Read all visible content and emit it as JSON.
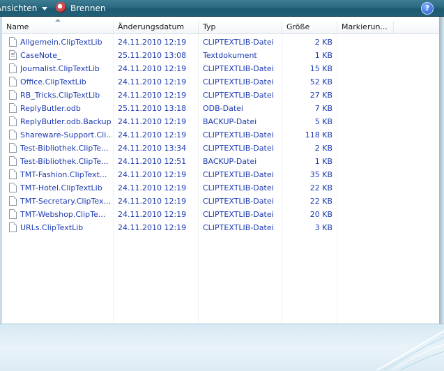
{
  "toolbar": {
    "views_label": "Ansichten",
    "burn_label": "Brennen",
    "help_label": "?"
  },
  "columns": {
    "name": "Name",
    "date": "Änderungsdatum",
    "type": "Typ",
    "size": "Größe",
    "tags": "Markierun..."
  },
  "files": [
    {
      "name": "Allgemein.ClipTextLib",
      "date": "24.11.2010 12:19",
      "type": "CLIPTEXTLIB-Datei",
      "size": "2 KB",
      "icon": "file-icon"
    },
    {
      "name": "CaseNote_",
      "date": "25.11.2010 13:08",
      "type": "Textdokument",
      "size": "1 KB",
      "icon": "text-file-icon"
    },
    {
      "name": "Journalist.ClipTextLib",
      "date": "24.11.2010 12:19",
      "type": "CLIPTEXTLIB-Datei",
      "size": "15 KB",
      "icon": "file-icon"
    },
    {
      "name": "Office.ClipTextLib",
      "date": "24.11.2010 12:19",
      "type": "CLIPTEXTLIB-Datei",
      "size": "52 KB",
      "icon": "file-icon"
    },
    {
      "name": "RB_Tricks.ClipTextLib",
      "date": "24.11.2010 12:19",
      "type": "CLIPTEXTLIB-Datei",
      "size": "27 KB",
      "icon": "file-icon"
    },
    {
      "name": "ReplyButler.odb",
      "date": "25.11.2010 13:18",
      "type": "ODB-Datei",
      "size": "7 KB",
      "icon": "file-icon"
    },
    {
      "name": "ReplyButler.odb.Backup",
      "date": "24.11.2010 12:19",
      "type": "BACKUP-Datei",
      "size": "5 KB",
      "icon": "file-icon"
    },
    {
      "name": "Shareware-Support.Cli...",
      "date": "24.11.2010 12:19",
      "type": "CLIPTEXTLIB-Datei",
      "size": "118 KB",
      "icon": "file-icon"
    },
    {
      "name": "Test-Bibliothek.ClipTe...",
      "date": "24.11.2010 13:34",
      "type": "CLIPTEXTLIB-Datei",
      "size": "2 KB",
      "icon": "file-icon"
    },
    {
      "name": "Test-Bibliothek.ClipTe...",
      "date": "24.11.2010 12:51",
      "type": "BACKUP-Datei",
      "size": "1 KB",
      "icon": "file-icon"
    },
    {
      "name": "TMT-Fashion.ClipText...",
      "date": "24.11.2010 12:19",
      "type": "CLIPTEXTLIB-Datei",
      "size": "35 KB",
      "icon": "file-icon"
    },
    {
      "name": "TMT-Hotel.ClipTextLib",
      "date": "24.11.2010 12:19",
      "type": "CLIPTEXTLIB-Datei",
      "size": "22 KB",
      "icon": "file-icon"
    },
    {
      "name": "TMT-Secretary.ClipTex...",
      "date": "24.11.2010 12:19",
      "type": "CLIPTEXTLIB-Datei",
      "size": "22 KB",
      "icon": "file-icon"
    },
    {
      "name": "TMT-Webshop.ClipTe...",
      "date": "24.11.2010 12:19",
      "type": "CLIPTEXTLIB-Datei",
      "size": "20 KB",
      "icon": "file-icon"
    },
    {
      "name": "URLs.ClipTextLib",
      "date": "24.11.2010 12:19",
      "type": "CLIPTEXTLIB-Datei",
      "size": "3 KB",
      "icon": "file-icon"
    }
  ],
  "colors": {
    "toolbar": "#2b6a80",
    "file_text": "#1c3bb1",
    "bottom_panel": "#e0eef6"
  }
}
